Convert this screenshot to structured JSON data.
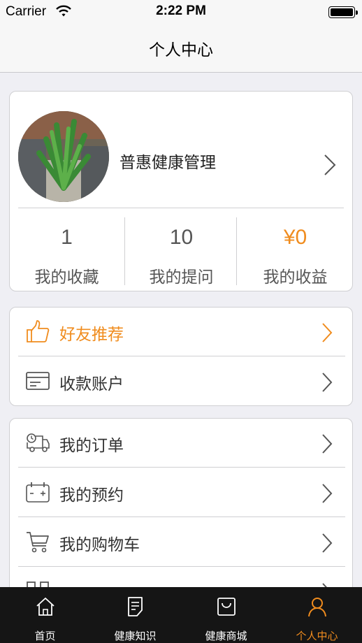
{
  "status_bar": {
    "carrier": "Carrier",
    "time": "2:22 PM"
  },
  "nav": {
    "title": "个人中心"
  },
  "profile": {
    "name": "普惠健康管理",
    "stats": [
      {
        "value": "1",
        "label": "我的收藏"
      },
      {
        "value": "10",
        "label": "我的提问"
      },
      {
        "value": "¥0",
        "label": "我的收益",
        "highlight": true
      }
    ]
  },
  "menu_group_1": [
    {
      "label": "好友推荐",
      "icon": "thumbs-up-icon",
      "highlight": true
    },
    {
      "label": "收款账户",
      "icon": "card-icon"
    }
  ],
  "menu_group_2": [
    {
      "label": "我的订单",
      "icon": "delivery-truck-icon"
    },
    {
      "label": "我的预约",
      "icon": "calendar-icon"
    },
    {
      "label": "我的购物车",
      "icon": "cart-icon"
    }
  ],
  "tab_bar": {
    "items": [
      {
        "label": "首页",
        "icon": "home-icon"
      },
      {
        "label": "健康知识",
        "icon": "document-icon"
      },
      {
        "label": "健康商城",
        "icon": "bag-icon"
      },
      {
        "label": "个人中心",
        "icon": "person-icon",
        "active": true
      }
    ]
  },
  "colors": {
    "accent": "#f08c1e",
    "background": "#efeff4",
    "tab_bar": "#151515"
  }
}
